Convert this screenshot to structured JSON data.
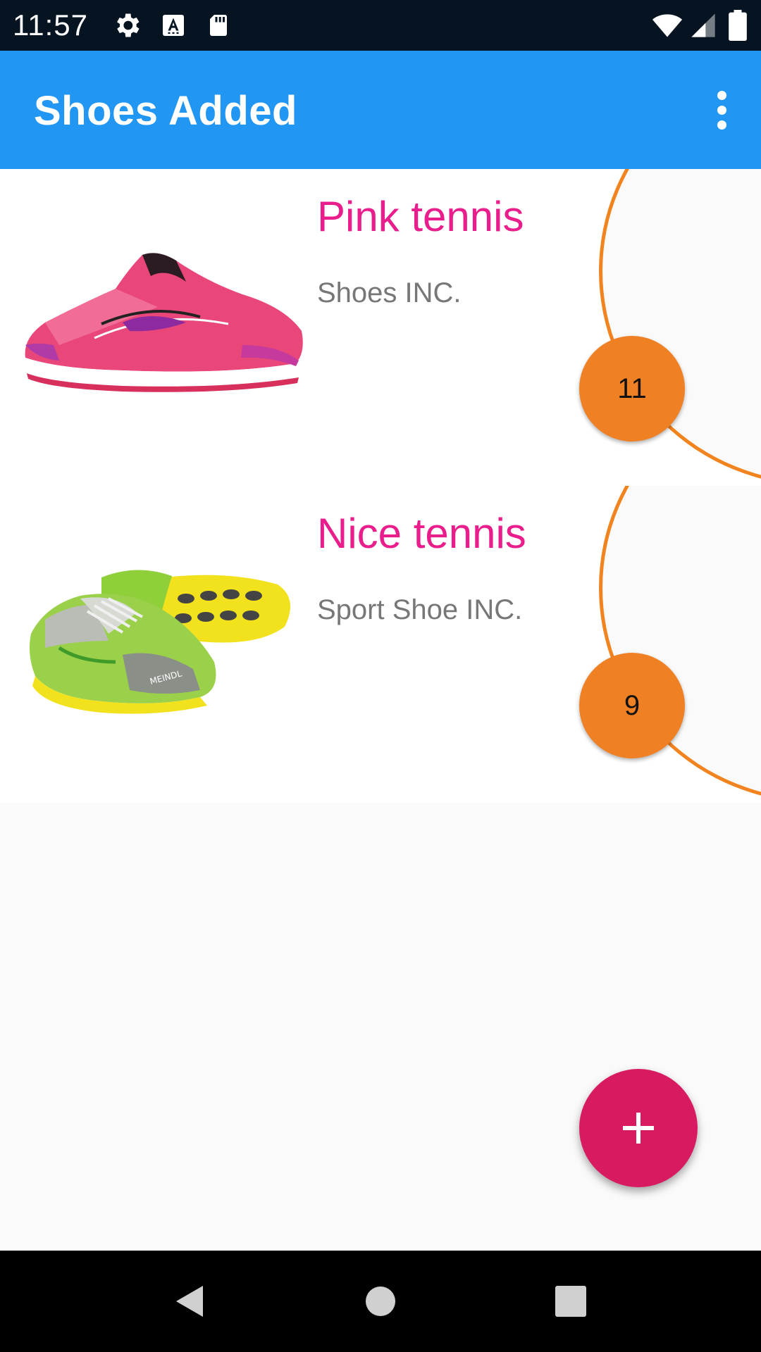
{
  "status_bar": {
    "time": "11:57",
    "icons": [
      "settings-icon",
      "text-a-icon",
      "sd-card-icon",
      "wifi-icon",
      "cell-signal-icon",
      "battery-icon"
    ]
  },
  "app_bar": {
    "title": "Shoes Added",
    "menu_icon": "more-vert-icon"
  },
  "shoes": [
    {
      "name": "Pink tennis",
      "brand": "Shoes INC.",
      "size": "11",
      "image": "pink-running-shoe"
    },
    {
      "name": "Nice tennis",
      "brand": "Sport Shoe INC.",
      "size": "9",
      "image": "green-yellow-trail-shoe"
    }
  ],
  "fab": {
    "icon": "plus-icon"
  },
  "nav_bar": {
    "icons": [
      "back-icon",
      "home-icon",
      "recents-icon"
    ]
  },
  "colors": {
    "status_bar": "#061421",
    "app_bar": "#2196f3",
    "shoe_name": "#e91e8c",
    "size_badge": "#f08024",
    "fab": "#d81b60",
    "arc": "#f2841f"
  }
}
